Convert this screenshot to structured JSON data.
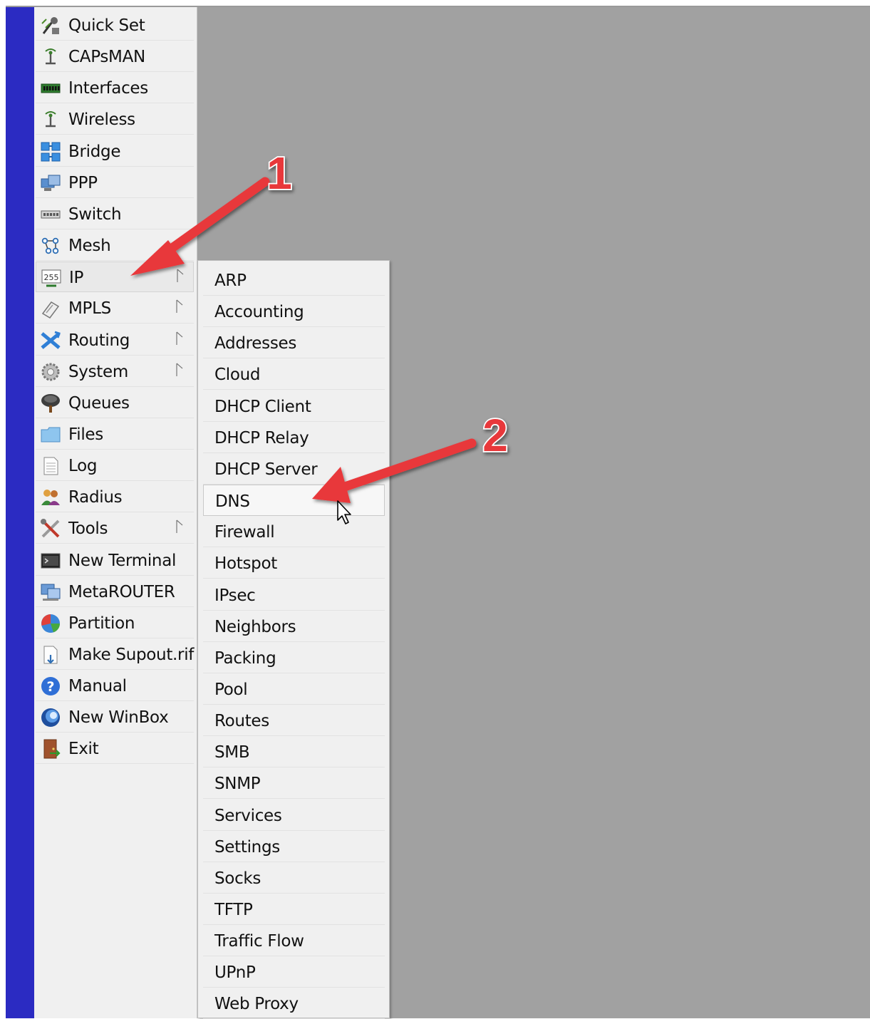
{
  "main_menu": {
    "items": [
      {
        "label": "Quick Set",
        "icon": "quick-set-icon",
        "submenu": false
      },
      {
        "label": "CAPsMAN",
        "icon": "capsman-antenna-icon",
        "submenu": false
      },
      {
        "label": "Interfaces",
        "icon": "interfaces-card-icon",
        "submenu": false
      },
      {
        "label": "Wireless",
        "icon": "wireless-antenna-icon",
        "submenu": false
      },
      {
        "label": "Bridge",
        "icon": "bridge-icon",
        "submenu": false
      },
      {
        "label": "PPP",
        "icon": "ppp-icon",
        "submenu": false
      },
      {
        "label": "Switch",
        "icon": "switch-icon",
        "submenu": false
      },
      {
        "label": "Mesh",
        "icon": "mesh-icon",
        "submenu": false
      },
      {
        "label": "IP",
        "icon": "ip-255-icon",
        "submenu": true
      },
      {
        "label": "MPLS",
        "icon": "mpls-icon",
        "submenu": true
      },
      {
        "label": "Routing",
        "icon": "routing-icon",
        "submenu": true
      },
      {
        "label": "System",
        "icon": "system-gear-icon",
        "submenu": true
      },
      {
        "label": "Queues",
        "icon": "queues-tree-icon",
        "submenu": false
      },
      {
        "label": "Files",
        "icon": "files-folder-icon",
        "submenu": false
      },
      {
        "label": "Log",
        "icon": "log-document-icon",
        "submenu": false
      },
      {
        "label": "Radius",
        "icon": "radius-users-icon",
        "submenu": false
      },
      {
        "label": "Tools",
        "icon": "tools-icon",
        "submenu": true
      },
      {
        "label": "New Terminal",
        "icon": "terminal-icon",
        "submenu": false
      },
      {
        "label": "MetaROUTER",
        "icon": "metarouter-icon",
        "submenu": false
      },
      {
        "label": "Partition",
        "icon": "partition-pie-icon",
        "submenu": false
      },
      {
        "label": "Make Supout.rif",
        "icon": "supout-file-icon",
        "submenu": false
      },
      {
        "label": "Manual",
        "icon": "manual-help-icon",
        "submenu": false
      },
      {
        "label": "New WinBox",
        "icon": "winbox-globe-icon",
        "submenu": false
      },
      {
        "label": "Exit",
        "icon": "exit-door-icon",
        "submenu": false
      }
    ]
  },
  "ip_submenu": {
    "items": [
      "ARP",
      "Accounting",
      "Addresses",
      "Cloud",
      "DHCP Client",
      "DHCP Relay",
      "DHCP Server",
      "DNS",
      "Firewall",
      "Hotspot",
      "IPsec",
      "Neighbors",
      "Packing",
      "Pool",
      "Routes",
      "SMB",
      "SNMP",
      "Services",
      "Settings",
      "Socks",
      "TFTP",
      "Traffic Flow",
      "UPnP",
      "Web Proxy"
    ],
    "hovered": "DNS"
  },
  "annotations": {
    "step_1": "1",
    "step_2": "2",
    "arrow_color": "#e8383b"
  },
  "colors": {
    "sidebar_stripe": "#2b2bc2",
    "workspace": "#a1a1a1",
    "menu_bg": "#f0f0f0"
  }
}
